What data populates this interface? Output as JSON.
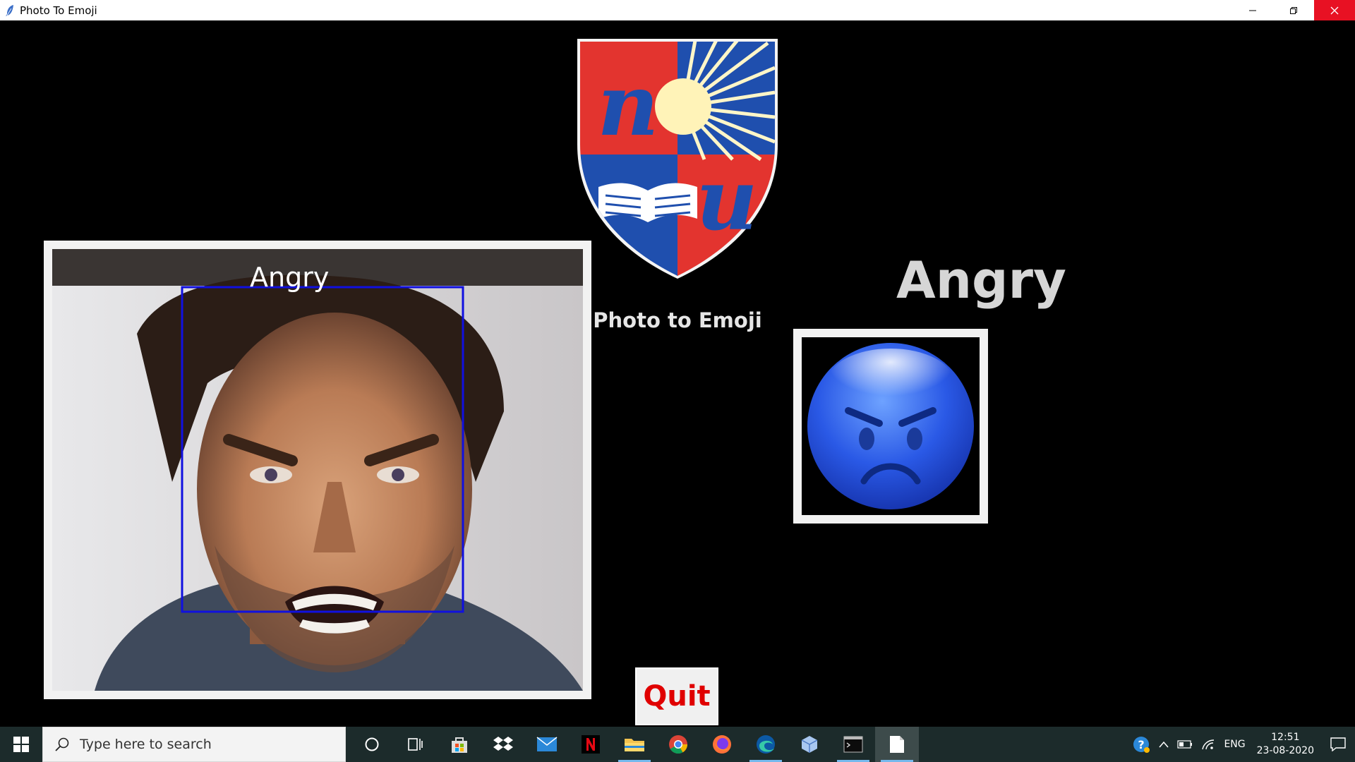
{
  "window": {
    "title": "Photo To Emoji",
    "controls": {
      "minimize_icon": "minimize-icon",
      "restore_icon": "restore-icon",
      "close_icon": "close-icon"
    }
  },
  "app": {
    "logo_letters": [
      "n",
      "u"
    ],
    "subtitle": "Photo to Emoji",
    "photo_face_label": "Angry",
    "emotion": "Angry",
    "quit_label": "Quit",
    "colors": {
      "quit_text": "#e00000",
      "face_box": "#1010e0",
      "emoji_blue": "#2a59e6",
      "logo_red": "#e3342f",
      "logo_blue": "#1f4fae"
    }
  },
  "taskbar": {
    "search_placeholder": "Type here to search",
    "apps": [
      "cortana-icon",
      "task-view-icon",
      "store-icon",
      "dropbox-icon",
      "mail-icon",
      "netflix-icon",
      "file-explorer-icon",
      "chrome-icon",
      "firefox-icon",
      "edge-icon",
      "3d-viewer-icon",
      "terminal-icon",
      "notepad-icon"
    ],
    "tray": {
      "language": "ENG",
      "time": "12:51",
      "date": "23-08-2020"
    }
  }
}
